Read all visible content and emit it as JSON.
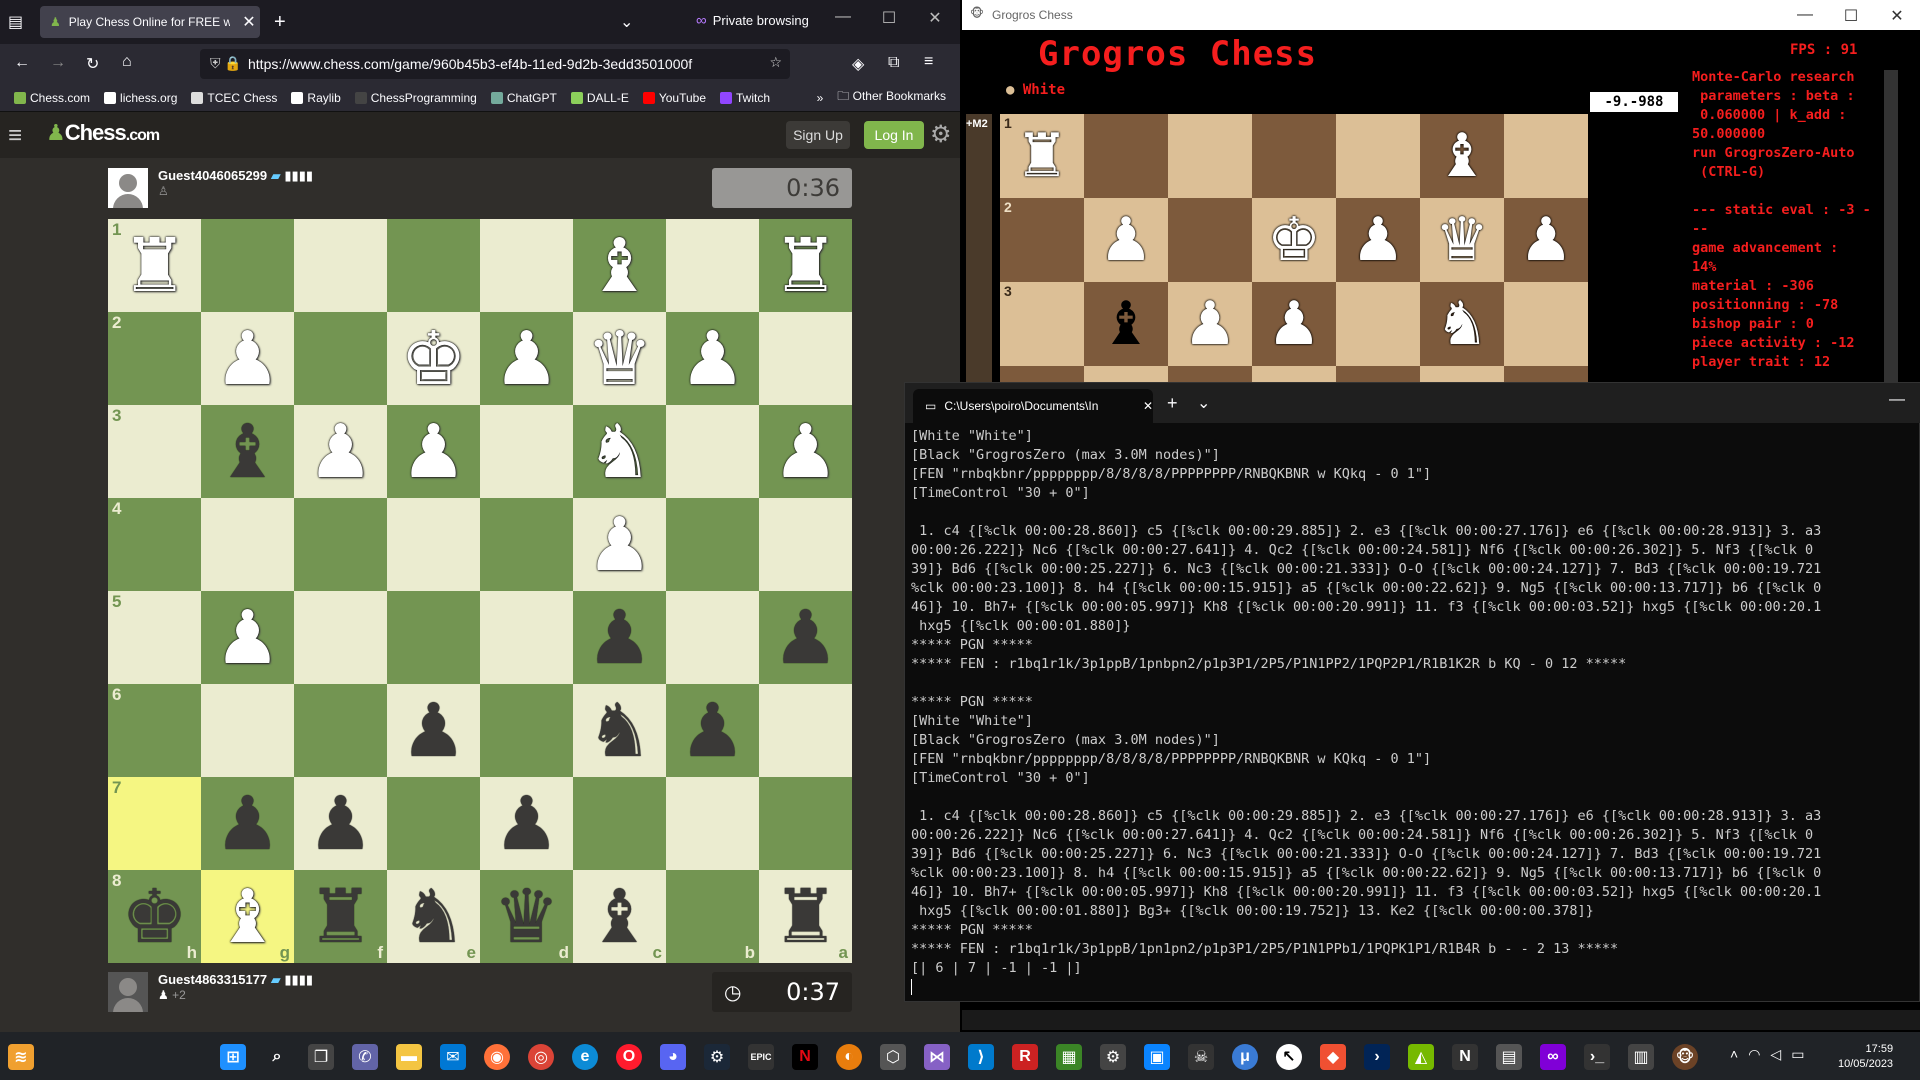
{
  "firefox": {
    "tab_title": "Play Chess Online for FREE with",
    "private_label": "Private browsing",
    "url": "https://www.chess.com/game/960b45b3-ef4b-11ed-9d2b-3edd3501000f",
    "bookmarks": [
      {
        "label": "Chess.com",
        "color": "#81b64c"
      },
      {
        "label": "lichess.org",
        "color": "#ffffff"
      },
      {
        "label": "TCEC Chess",
        "color": "#dddddd"
      },
      {
        "label": "Raylib",
        "color": "#ffffff"
      },
      {
        "label": "ChessProgramming",
        "color": "#444444"
      },
      {
        "label": "ChatGPT",
        "color": "#74aa9c"
      },
      {
        "label": "DALL-E",
        "color": "#8ccf5b"
      },
      {
        "label": "YouTube",
        "color": "#ff0000"
      },
      {
        "label": "Twitch",
        "color": "#9146ff"
      }
    ],
    "other_bookmarks": "Other Bookmarks"
  },
  "chesscom": {
    "logo_main": "Chess",
    "logo_suffix": ".com",
    "signup": "Sign Up",
    "login": "Log In",
    "top_player": {
      "name": "Guest4046065299",
      "clock": "0:36"
    },
    "bottom_player": {
      "name": "Guest4863315177",
      "captured": "+2",
      "clock": "0:37"
    },
    "ranks": [
      "1",
      "2",
      "3",
      "4",
      "5",
      "6",
      "7",
      "8"
    ],
    "files": [
      "h",
      "g",
      "f",
      "e",
      "d",
      "c",
      "b",
      "a"
    ],
    "board": [
      "R....B.R",
      ".P.KPQP.",
      ".bPP.N.P",
      ".....P..",
      ".P...p.p",
      "...p.np.",
      ".pp.p...",
      "kBrnqb.r"
    ],
    "highlight": [
      "8-0",
      "9-0"
    ],
    "highlight_squares": [
      [
        6,
        0
      ],
      [
        7,
        1
      ]
    ]
  },
  "grogros": {
    "window_title": "Grogros Chess",
    "logo": "Grogros Chess",
    "fps": "FPS : 91",
    "side": "White",
    "eval": "-9.-988",
    "strip_label": "+M2",
    "info": "Monte-Carlo research\n parameters : beta :\n 0.060000 | k_add :\n50.000000\nrun GrogrosZero-Auto\n (CTRL-G)\n\n--- static eval : -3 -\n--\ngame advancement :\n14%\nmaterial : -306\npositionning : -78\nbishop pair : 0\npiece activity : -12\nplayer trait : 12",
    "ranks": [
      "1",
      "2",
      "3"
    ],
    "board": [
      "R....B.R",
      ".P.KPQP.",
      ".bPP.N.P"
    ]
  },
  "terminal": {
    "tab_title": "C:\\Users\\poiro\\Documents\\In",
    "lines": [
      "[White \"White\"]",
      "[Black \"GrogrosZero (max 3.0M nodes)\"]",
      "[FEN \"rnbqkbnr/pppppppp/8/8/8/8/PPPPPPPP/RNBQKBNR w KQkq - 0 1\"]",
      "[TimeControl \"30 + 0\"]",
      "",
      " 1. c4 {[%clk 00:00:28.860]} c5 {[%clk 00:00:29.885]} 2. e3 {[%clk 00:00:27.176]} e6 {[%clk 00:00:28.913]} 3. a3",
      "00:00:26.222]} Nc6 {[%clk 00:00:27.641]} 4. Qc2 {[%clk 00:00:24.581]} Nf6 {[%clk 00:00:26.302]} 5. Nf3 {[%clk 0",
      "39]} Bd6 {[%clk 00:00:25.227]} 6. Nc3 {[%clk 00:00:21.333]} O-O {[%clk 00:00:24.127]} 7. Bd3 {[%clk 00:00:19.721",
      "%clk 00:00:23.100]} 8. h4 {[%clk 00:00:15.915]} a5 {[%clk 00:00:22.62]} 9. Ng5 {[%clk 00:00:13.717]} b6 {[%clk 0",
      "46]} 10. Bh7+ {[%clk 00:00:05.997]} Kh8 {[%clk 00:00:20.991]} 11. f3 {[%clk 00:00:03.52]} hxg5 {[%clk 00:00:20.1",
      " hxg5 {[%clk 00:00:01.880]}",
      "***** PGN *****",
      "***** FEN : r1bq1r1k/3p1ppB/1pnbpn2/p1p3P1/2P5/P1N1PP2/1PQP2P1/R1B1K2R b KQ - 0 12 *****",
      "",
      "***** PGN *****",
      "[White \"White\"]",
      "[Black \"GrogrosZero (max 3.0M nodes)\"]",
      "[FEN \"rnbqkbnr/pppppppp/8/8/8/8/PPPPPPPP/RNBQKBNR w KQkq - 0 1\"]",
      "[TimeControl \"30 + 0\"]",
      "",
      " 1. c4 {[%clk 00:00:28.860]} c5 {[%clk 00:00:29.885]} 2. e3 {[%clk 00:00:27.176]} e6 {[%clk 00:00:28.913]} 3. a3",
      "00:00:26.222]} Nc6 {[%clk 00:00:27.641]} 4. Qc2 {[%clk 00:00:24.581]} Nf6 {[%clk 00:00:26.302]} 5. Nf3 {[%clk 0",
      "39]} Bd6 {[%clk 00:00:25.227]} 6. Nc3 {[%clk 00:00:21.333]} O-O {[%clk 00:00:24.127]} 7. Bd3 {[%clk 00:00:19.721",
      "%clk 00:00:23.100]} 8. h4 {[%clk 00:00:15.915]} a5 {[%clk 00:00:22.62]} 9. Ng5 {[%clk 00:00:13.717]} b6 {[%clk 0",
      "46]} 10. Bh7+ {[%clk 00:00:05.997]} Kh8 {[%clk 00:00:20.991]} 11. f3 {[%clk 00:00:03.52]} hxg5 {[%clk 00:00:20.1",
      " hxg5 {[%clk 00:00:01.880]} Bg3+ {[%clk 00:00:19.752]} 13. Ke2 {[%clk 00:00:00.378]}",
      "***** PGN *****",
      "***** FEN : r1bq1r1k/3p1ppB/1pn1pn2/p1p3P1/2P5/P1N1PPb1/1PQPK1P1/R1B4R b - - 2 13 *****",
      "[| 6 | 7 | -1 | -1 |]"
    ]
  },
  "system": {
    "time": "17:59",
    "date": "10/05/2023"
  }
}
